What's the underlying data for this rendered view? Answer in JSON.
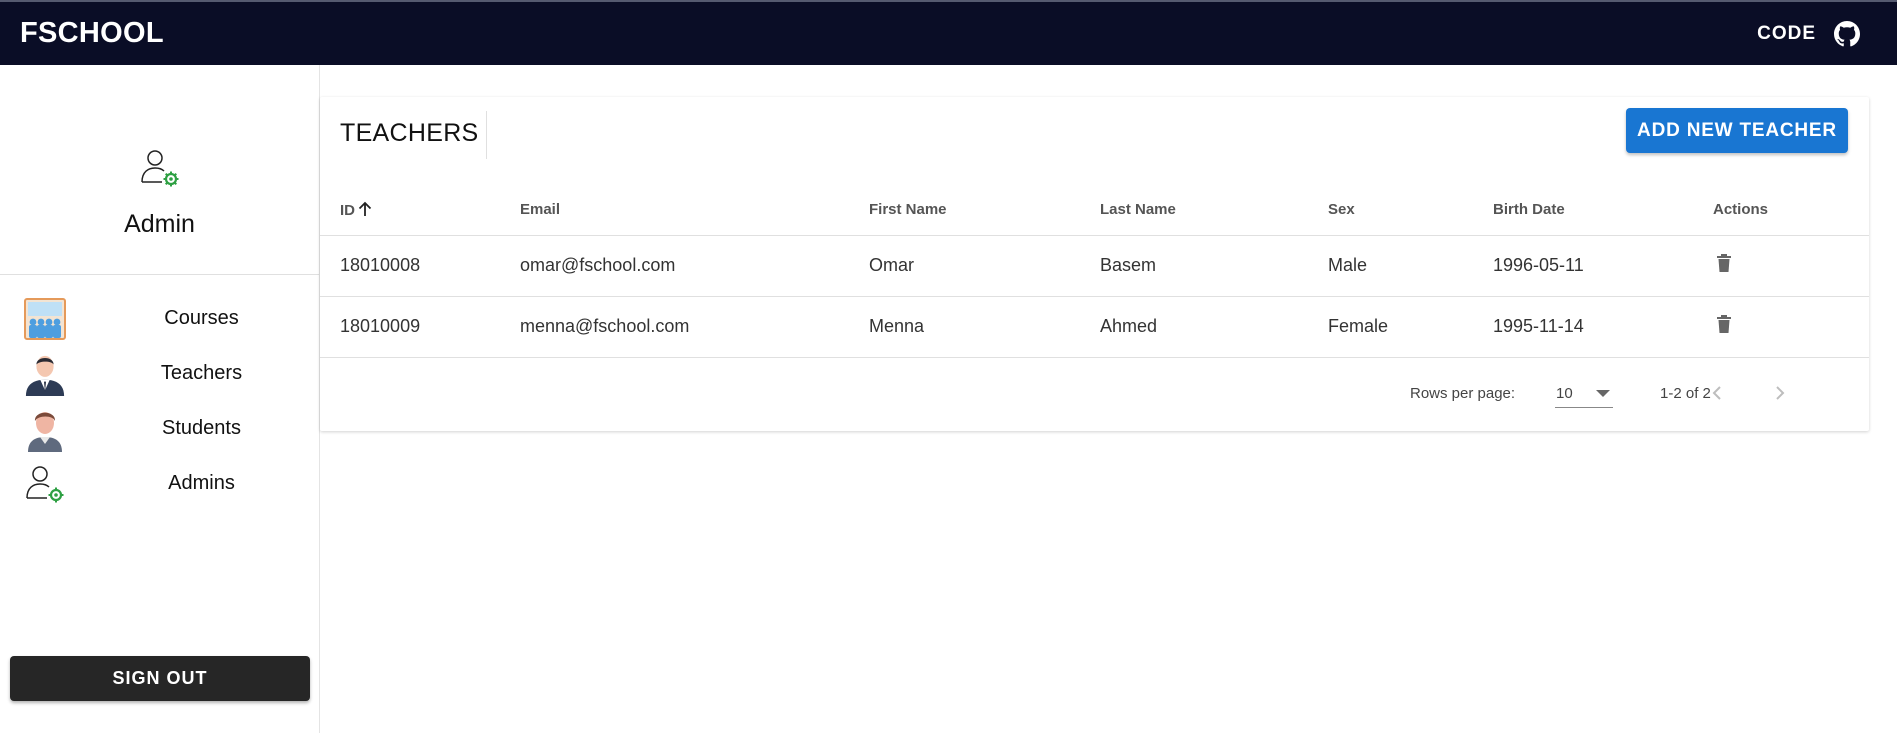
{
  "header": {
    "brand": "FSCHOOL",
    "code_label": "CODE",
    "github_icon": "github-icon",
    "background": "#0a0d26"
  },
  "sidebar": {
    "profile_icon": "admin-user-gear-icon",
    "profile_name": "Admin",
    "items": [
      {
        "label": "Courses",
        "icon": "classroom-icon"
      },
      {
        "label": "Teachers",
        "icon": "teacher-avatar-icon"
      },
      {
        "label": "Students",
        "icon": "student-avatar-icon"
      },
      {
        "label": "Admins",
        "icon": "admin-user-gear-icon"
      }
    ],
    "sign_out_label": "SIGN OUT"
  },
  "main": {
    "title": "TEACHERS",
    "add_button_label": "ADD NEW TEACHER",
    "accent": "#1976d2",
    "table": {
      "columns": [
        "ID",
        "Email",
        "First Name",
        "Last Name",
        "Sex",
        "Birth Date",
        "Actions"
      ],
      "sort_column": "ID",
      "sort_direction": "ascending",
      "rows": [
        {
          "id": "18010008",
          "email": "omar@fschool.com",
          "first_name": "Omar",
          "last_name": "Basem",
          "sex": "Male",
          "birth_date": "1996-05-11",
          "action_icon": "trash-icon"
        },
        {
          "id": "18010009",
          "email": "menna@fschool.com",
          "first_name": "Menna",
          "last_name": "Ahmed",
          "sex": "Female",
          "birth_date": "1995-11-14",
          "action_icon": "trash-icon"
        }
      ]
    },
    "pagination": {
      "rows_per_page_label": "Rows per page:",
      "rows_per_page_value": "10",
      "range_text": "1-2 of 2"
    }
  }
}
